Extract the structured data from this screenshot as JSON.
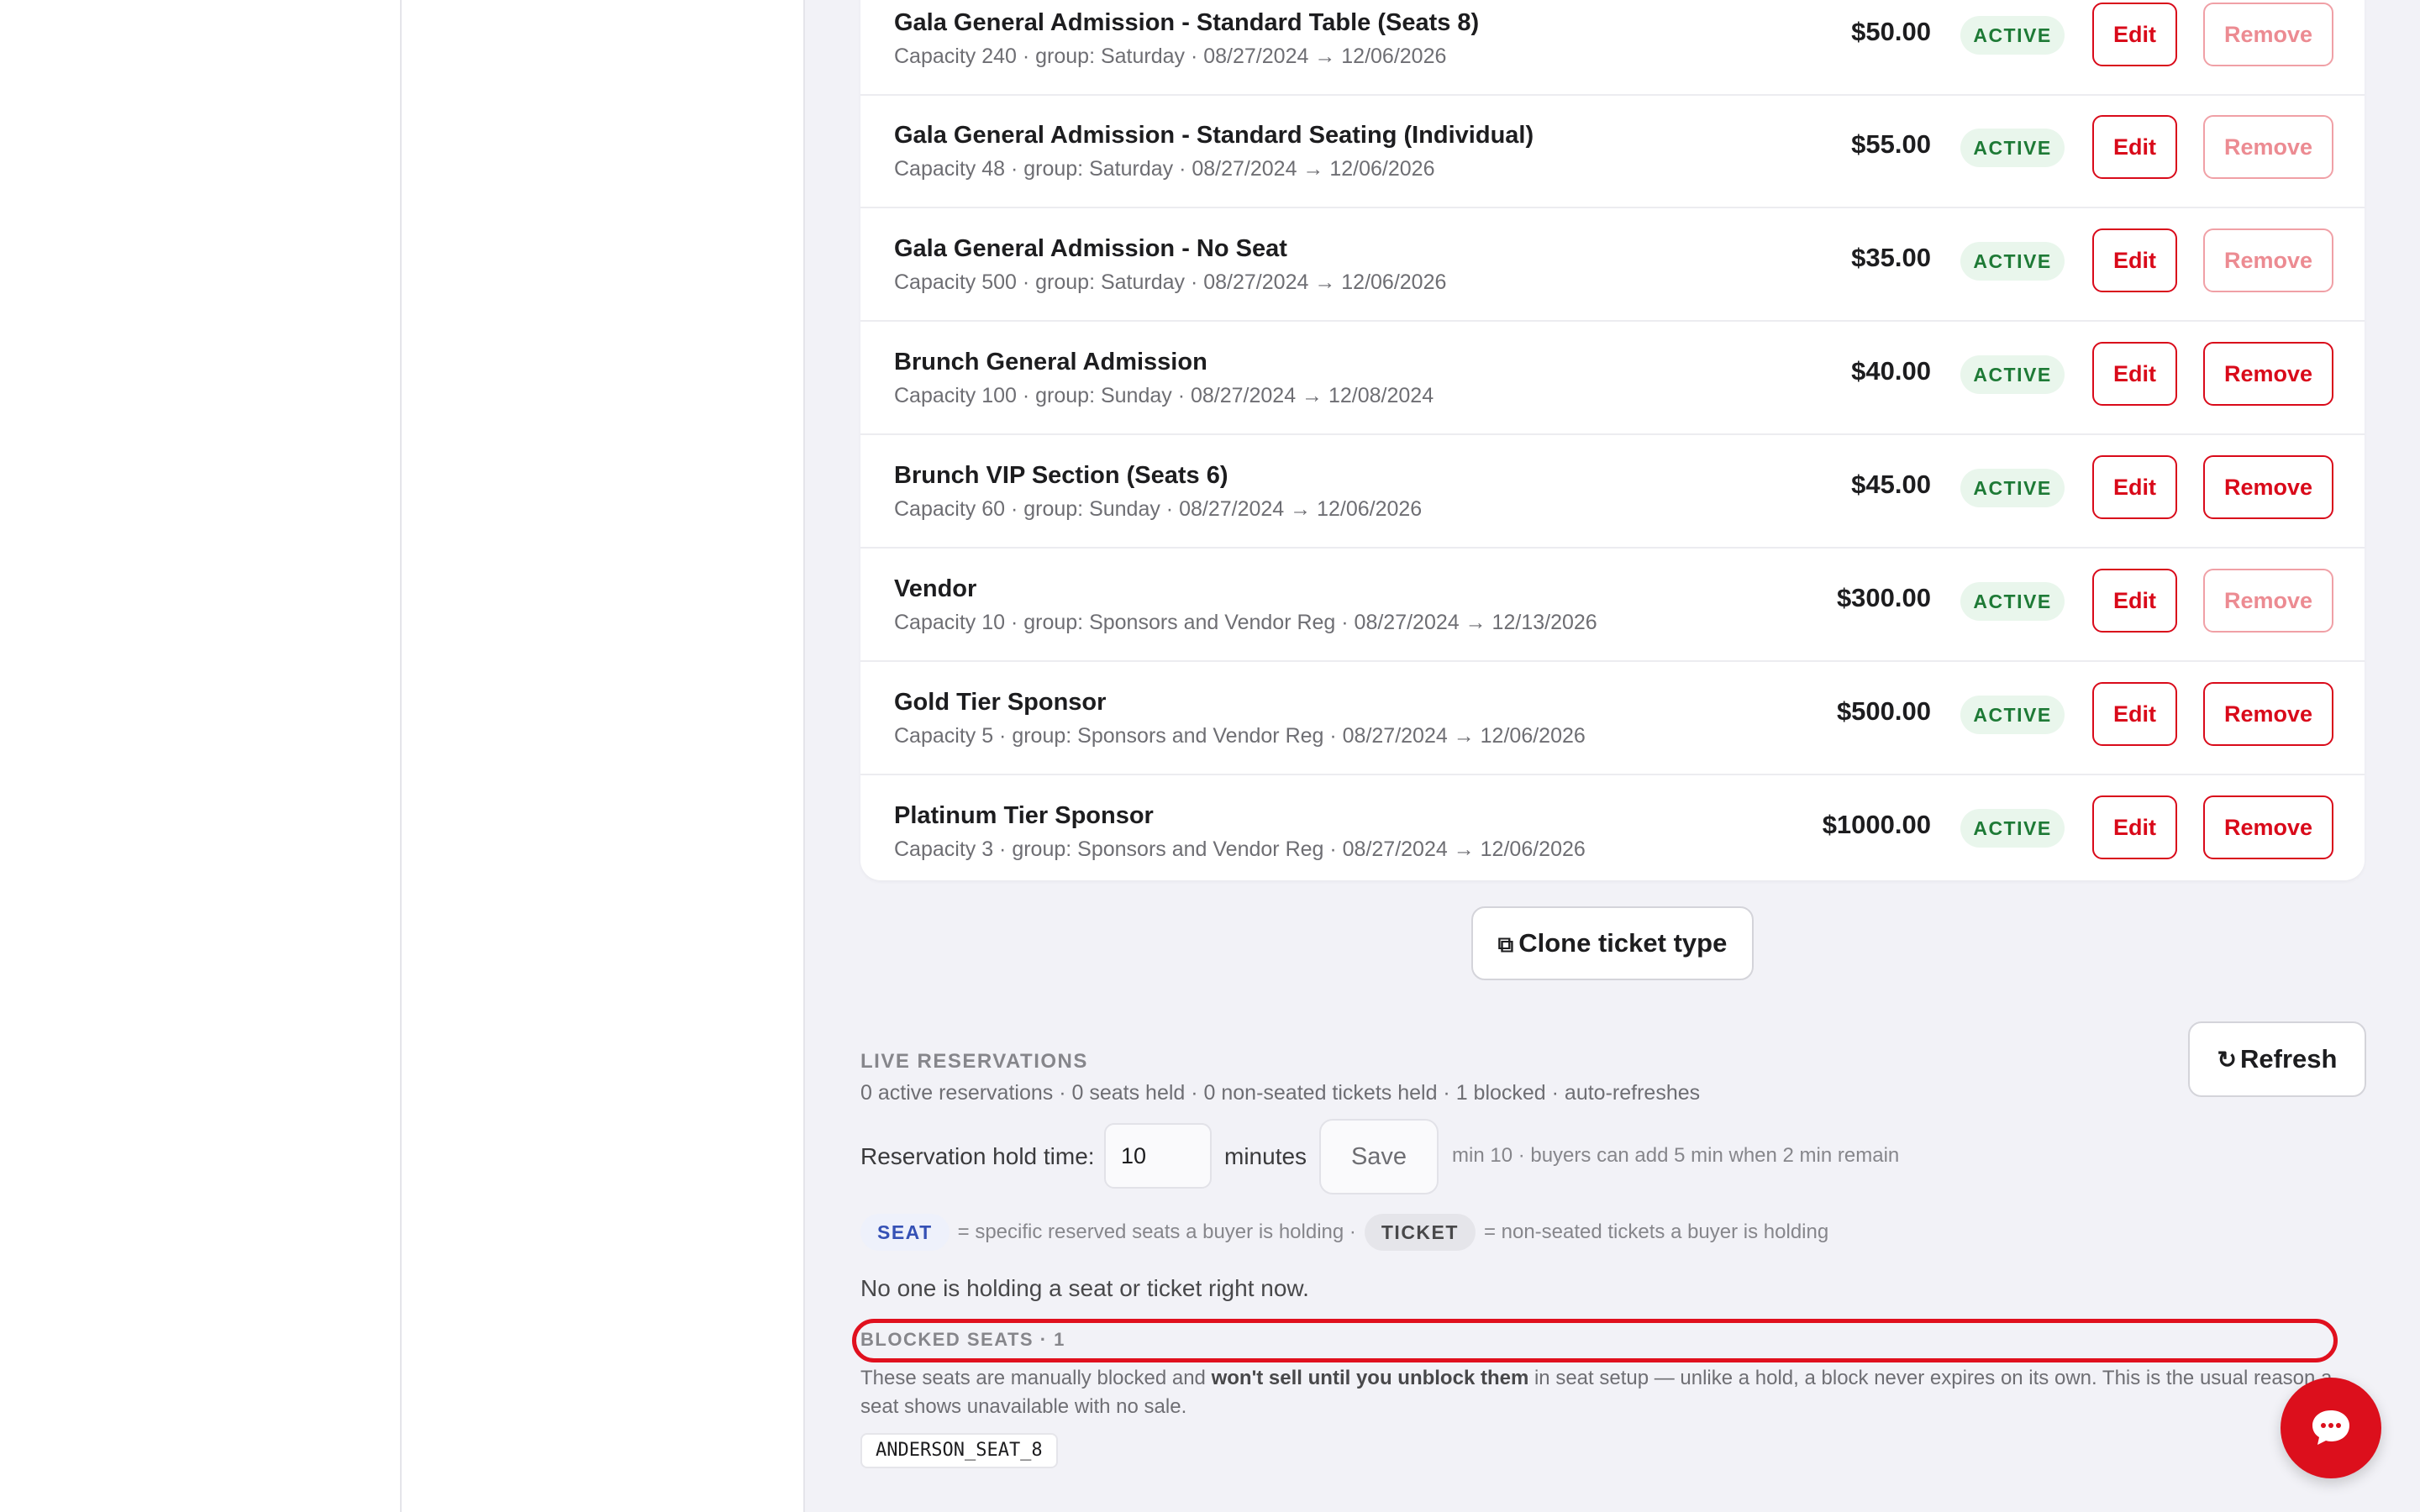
{
  "tickets": [
    {
      "name": "Gala General Admission - Standard Table (Seats 8)",
      "meta": "Capacity 240 · group: Saturday · 08/27/2024 → 12/06/2026",
      "price": "$50.00",
      "status": "ACTIVE",
      "edit_label": "Edit",
      "remove_label": "Remove",
      "remove_enabled": false
    },
    {
      "name": "Gala General Admission - Standard Seating (Individual)",
      "meta": "Capacity 48 · group: Saturday · 08/27/2024 → 12/06/2026",
      "price": "$55.00",
      "status": "ACTIVE",
      "edit_label": "Edit",
      "remove_label": "Remove",
      "remove_enabled": false
    },
    {
      "name": "Gala General Admission - No Seat",
      "meta": "Capacity 500 · group: Saturday · 08/27/2024 → 12/06/2026",
      "price": "$35.00",
      "status": "ACTIVE",
      "edit_label": "Edit",
      "remove_label": "Remove",
      "remove_enabled": false
    },
    {
      "name": "Brunch General Admission",
      "meta": "Capacity 100 · group: Sunday · 08/27/2024 → 12/08/2024",
      "price": "$40.00",
      "status": "ACTIVE",
      "edit_label": "Edit",
      "remove_label": "Remove",
      "remove_enabled": true
    },
    {
      "name": "Brunch VIP Section (Seats 6)",
      "meta": "Capacity 60 · group: Sunday · 08/27/2024 → 12/06/2026",
      "price": "$45.00",
      "status": "ACTIVE",
      "edit_label": "Edit",
      "remove_label": "Remove",
      "remove_enabled": true
    },
    {
      "name": "Vendor",
      "meta": "Capacity 10 · group: Sponsors and Vendor Reg · 08/27/2024 → 12/13/2026",
      "price": "$300.00",
      "status": "ACTIVE",
      "edit_label": "Edit",
      "remove_label": "Remove",
      "remove_enabled": false
    },
    {
      "name": "Gold Tier Sponsor",
      "meta": "Capacity 5 · group: Sponsors and Vendor Reg · 08/27/2024 → 12/06/2026",
      "price": "$500.00",
      "status": "ACTIVE",
      "edit_label": "Edit",
      "remove_label": "Remove",
      "remove_enabled": true
    },
    {
      "name": "Platinum Tier Sponsor",
      "meta": "Capacity 3 · group: Sponsors and Vendor Reg · 08/27/2024 → 12/06/2026",
      "price": "$1000.00",
      "status": "ACTIVE",
      "edit_label": "Edit",
      "remove_label": "Remove",
      "remove_enabled": true
    }
  ],
  "clone": {
    "icon": "copy-icon",
    "label": "Clone ticket type"
  },
  "live": {
    "title": "LIVE RESERVATIONS",
    "summary": "0 active reservations · 0 seats held · 0 non-seated tickets held · 1 blocked · auto-refreshes",
    "refresh_icon": "refresh-icon",
    "refresh_label": "Refresh"
  },
  "hold": {
    "label": "Reservation hold time:",
    "value": "10",
    "unit": "minutes",
    "save_label": "Save",
    "hint": "min 10 · buyers can add 5 min when 2 min remain"
  },
  "legend": {
    "seat_pill": "SEAT",
    "seat_text": "= specific reserved seats a buyer is holding ·",
    "ticket_pill": "TICKET",
    "ticket_text": "= non-seated tickets a buyer is holding"
  },
  "empty_state": "No one is holding a seat or ticket right now.",
  "blocked": {
    "title": "BLOCKED SEATS · 1",
    "desc_before": "These seats are manually blocked and ",
    "desc_bold": "won't sell until you unblock them",
    "desc_after": " in seat setup — unlike a hold, a block never expires on its own. This is the usual reason a seat shows unavailable with no sale.",
    "seats": [
      "ANDERSON_SEAT_8"
    ]
  },
  "chat": {
    "icon": "chat-bubble-icon"
  },
  "colors": {
    "accent": "#d90a1a",
    "active_bg": "#e9f6ec",
    "active_text": "#1e7a36",
    "highlight": "#e0101e"
  }
}
